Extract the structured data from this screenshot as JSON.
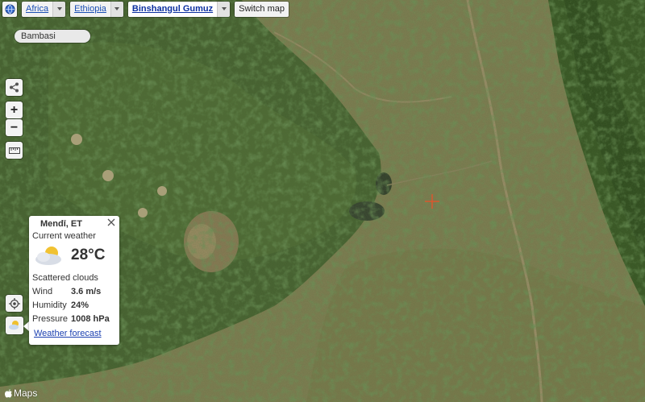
{
  "breadcrumb": {
    "items": [
      {
        "label": "Africa"
      },
      {
        "label": "Ethiopia"
      },
      {
        "label": "Binshangul Gumuz"
      }
    ],
    "switch_label": "Switch map"
  },
  "place_label": "Bambasi",
  "controls": {
    "zoom_in": "+",
    "zoom_out": "−"
  },
  "weather": {
    "location": "Mendī, ET",
    "heading": "Current weather",
    "temperature": "28°C",
    "condition": "Scattered clouds",
    "rows": [
      {
        "key": "Wind",
        "value": "3.6 m/s"
      },
      {
        "key": "Humidity",
        "value": "24%"
      },
      {
        "key": "Pressure",
        "value": "1008 hPa"
      }
    ],
    "forecast_link": "Weather forecast"
  },
  "attribution": "Maps",
  "colors": {
    "dark_green": "#3f5d2a",
    "light_tan": "#8d8a5c",
    "marker": "#d9582e",
    "link": "#1a4fb4"
  }
}
